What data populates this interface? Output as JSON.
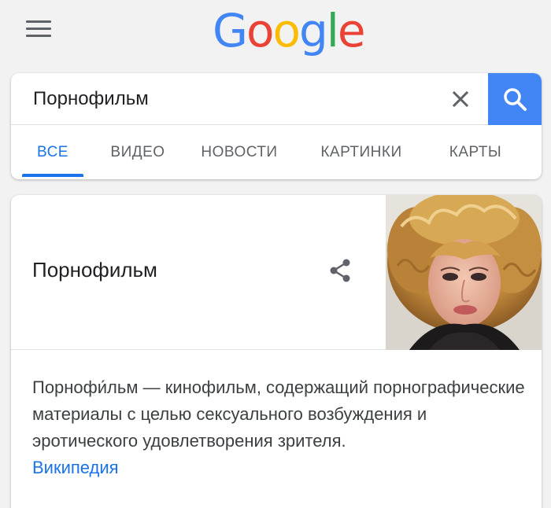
{
  "header": {
    "menu_icon": "hamburger-menu-icon",
    "logo_letters": [
      {
        "char": "G",
        "color": "#4285f4"
      },
      {
        "char": "o",
        "color": "#ea4335"
      },
      {
        "char": "o",
        "color": "#fbbc05"
      },
      {
        "char": "g",
        "color": "#4285f4"
      },
      {
        "char": "l",
        "color": "#34a853"
      },
      {
        "char": "e",
        "color": "#ea4335"
      }
    ]
  },
  "search": {
    "query": "Порнофильм",
    "clear_icon": "close-icon",
    "search_icon": "search-icon",
    "accent": "#4285f4"
  },
  "tabs": [
    {
      "label": "ВСЕ",
      "active": true
    },
    {
      "label": "ВИДЕО",
      "active": false
    },
    {
      "label": "НОВОСТИ",
      "active": false
    },
    {
      "label": "КАРТИНКИ",
      "active": false
    },
    {
      "label": "КАРТЫ",
      "active": false
    }
  ],
  "knowledge_panel": {
    "title": "Порнофильм",
    "share_icon": "share-icon",
    "description": "Порнофи́льм — кинофильм, содержащий порнографические материалы с целью сексуального возбуждения и эротического удовлетворения зрителя.",
    "source_label": "Википедия",
    "link_color": "#1a73e8"
  }
}
